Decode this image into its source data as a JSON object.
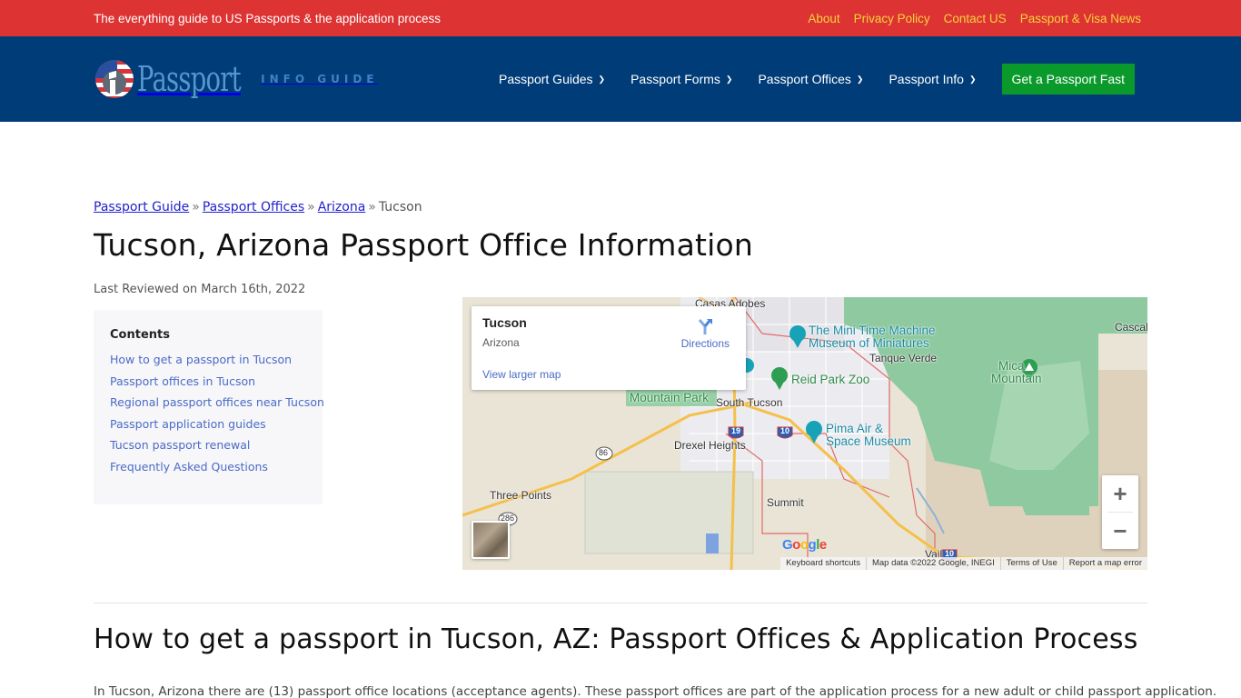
{
  "topbar": {
    "tagline": "The everything guide to US Passports & the application process",
    "links": [
      "About",
      "Privacy Policy",
      "Contact US",
      "Passport & Visa News"
    ]
  },
  "header": {
    "logo_word": "Passport",
    "logo_sub": "INFO GUIDE",
    "nav": [
      {
        "label": "Passport Guides",
        "icon": "chevron-down-icon"
      },
      {
        "label": "Passport Forms",
        "icon": "chevron-down-icon"
      },
      {
        "label": "Passport Offices",
        "icon": "chevron-down-icon"
      },
      {
        "label": "Passport Info",
        "icon": "chevron-down-icon"
      }
    ],
    "cta": "Get a Passport Fast",
    "colors": {
      "topbar": "#dd3333",
      "header": "#003c78",
      "cta": "#0a9a2b",
      "toplink": "#f6d33b"
    }
  },
  "breadcrumb": {
    "items": [
      "Passport Guide",
      "Passport Offices",
      "Arizona"
    ],
    "separator": "»",
    "current": "Tucson"
  },
  "page": {
    "title": "Tucson, Arizona Passport Office Information",
    "reviewed": "Last Reviewed on March 16th, 2022"
  },
  "toc": {
    "title": "Contents",
    "items": [
      "How to get a passport in Tucson",
      "Passport offices in Tucson",
      "Regional passport offices near Tucson",
      "Passport application guides",
      "Tucson passport renewal",
      "Frequently Asked Questions"
    ]
  },
  "map": {
    "card": {
      "place": "Tucson",
      "region": "Arizona",
      "directions": "Directions",
      "larger": "View larger map"
    },
    "labels": {
      "casas_adobes": "Casas Adobes",
      "cascabel": "Cascal",
      "mini_time_1": "The Mini Time Machine",
      "mini_time_2": "Museum of Miniatures",
      "tanque_verde": "Tanque Verde",
      "mica_1": "Mica",
      "mica_2": "Mountain",
      "reid_park": "Reid Park Zoo",
      "mountain_park": "Mountain Park",
      "south_tucson": "South Tucson",
      "pima_1": "Pima Air &",
      "pima_2": "Space Museum",
      "drexel": "Drexel Heights",
      "three_points": "Three Points",
      "summit": "Summit",
      "vail": "Vail",
      "route_86": "86",
      "route_286": "286",
      "i19": "19",
      "i10": "10",
      "i10b": "10"
    },
    "zoom_in": "+",
    "zoom_out": "−",
    "attribution": [
      "Keyboard shortcuts",
      "Map data ©2022 Google, INEGI",
      "Terms of Use",
      "Report a map error"
    ]
  },
  "section": {
    "title": "How to get a passport in Tucson, AZ: Passport Offices & Application Process",
    "intro": "In Tucson, Arizona there are (13) passport office locations (acceptance agents). These passport offices are part of the application process for a new adult or child passport application."
  }
}
